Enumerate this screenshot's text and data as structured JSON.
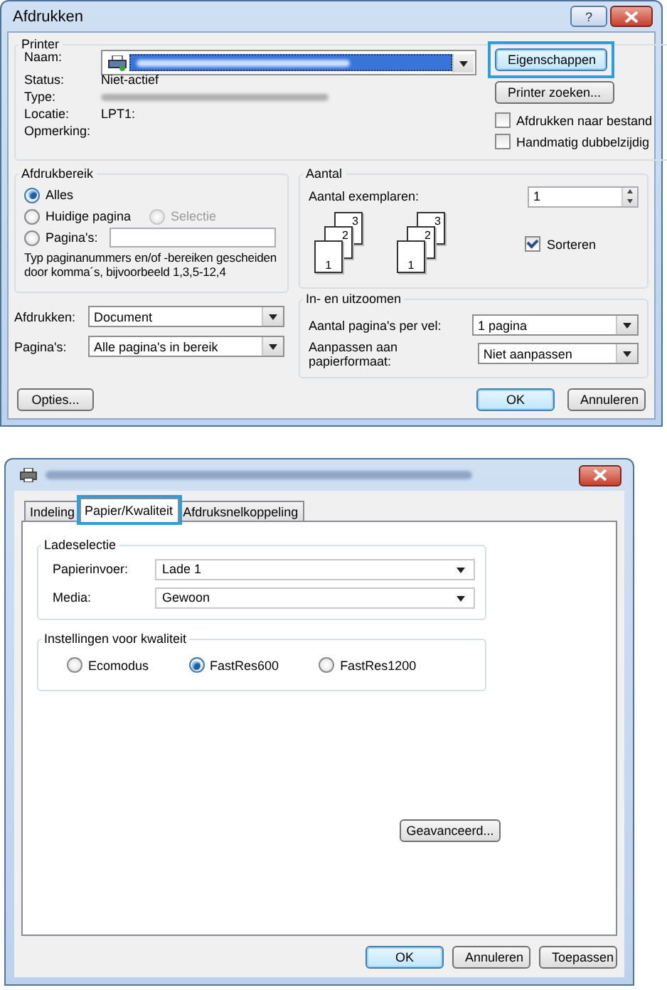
{
  "print_dialog": {
    "title": "Afdrukken",
    "help_button": "?",
    "printer": {
      "legend": "Printer",
      "name_label": "Naam:",
      "status_label": "Status:",
      "status": "Niet-actief",
      "type_label": "Type:",
      "location_label": "Locatie:",
      "location": "LPT1:",
      "comment_label": "Opmerking:",
      "properties_button": {
        "label": "Eigenschappen",
        "highlighted": true
      },
      "find_button": "Printer zoeken...",
      "checkboxes": [
        {
          "label": "Afdrukken naar bestand",
          "checked": false
        },
        {
          "label": "Handmatig dubbelzijdig",
          "checked": false
        }
      ]
    },
    "range": {
      "legend": "Afdrukbereik",
      "rows": [
        {
          "options": [
            {
              "kind": "radio",
              "label": "Alles",
              "selected": true,
              "disabled": false
            }
          ]
        },
        {
          "options": [
            {
              "kind": "radio",
              "label": "Huidige pagina",
              "selected": false,
              "disabled": false
            },
            {
              "kind": "radio",
              "label": "Selectie",
              "selected": false,
              "disabled": true
            }
          ]
        },
        {
          "options": [
            {
              "kind": "radio_field",
              "label": "Pagina's:",
              "selected": false,
              "disabled": false
            }
          ]
        }
      ],
      "hint": "Typ paginanummers en/of -bereiken gescheiden door komma´s, bijvoorbeeld 1,3,5-12,4"
    },
    "copies": {
      "legend": "Aantal",
      "label": "Aantal exemplaren:",
      "value": "1",
      "stacks": [
        {
          "pages": [
            "3",
            "2",
            "1"
          ]
        },
        {
          "pages": [
            "3",
            "2",
            "1"
          ]
        }
      ],
      "collate": {
        "label": "Sorteren",
        "checked": true
      }
    },
    "print_what": {
      "label": "Afdrukken:",
      "value": "Document"
    },
    "pages_select": {
      "label": "Pagina's:",
      "value": "Alle pagina's in bereik"
    },
    "zoom": {
      "legend": "In- en uitzoomen",
      "rows": [
        {
          "label": "Aantal pagina's per vel:",
          "value": "1 pagina"
        },
        {
          "label": "Aanpassen aan papierformaat:",
          "value": "Niet aanpassen"
        }
      ]
    },
    "options_button": "Opties...",
    "buttons": [
      {
        "label": "OK",
        "default": true
      },
      {
        "label": "Annuleren",
        "default": false
      }
    ]
  },
  "preferences_dialog": {
    "tabs": [
      {
        "label": "Indeling",
        "selected": false,
        "highlighted": false
      },
      {
        "label": "Papier/Kwaliteit",
        "selected": true,
        "highlighted": true
      },
      {
        "label": "Afdruksnelkoppeling",
        "selected": false,
        "highlighted": false
      }
    ],
    "tray": {
      "legend": "Ladeselectie",
      "rows": [
        {
          "label": "Papierinvoer:",
          "value": "Lade 1"
        },
        {
          "label": "Media:",
          "value": "Gewoon"
        }
      ]
    },
    "quality": {
      "legend": "Instellingen voor kwaliteit",
      "options": [
        {
          "label": "Ecomodus",
          "selected": false
        },
        {
          "label": "FastRes600",
          "selected": true
        },
        {
          "label": "FastRes1200",
          "selected": false
        }
      ]
    },
    "advanced_button": "Geavanceerd...",
    "buttons": [
      {
        "label": "OK",
        "default": true
      },
      {
        "label": "Annuleren",
        "default": false
      },
      {
        "label": "Toepassen",
        "default": false
      }
    ]
  }
}
